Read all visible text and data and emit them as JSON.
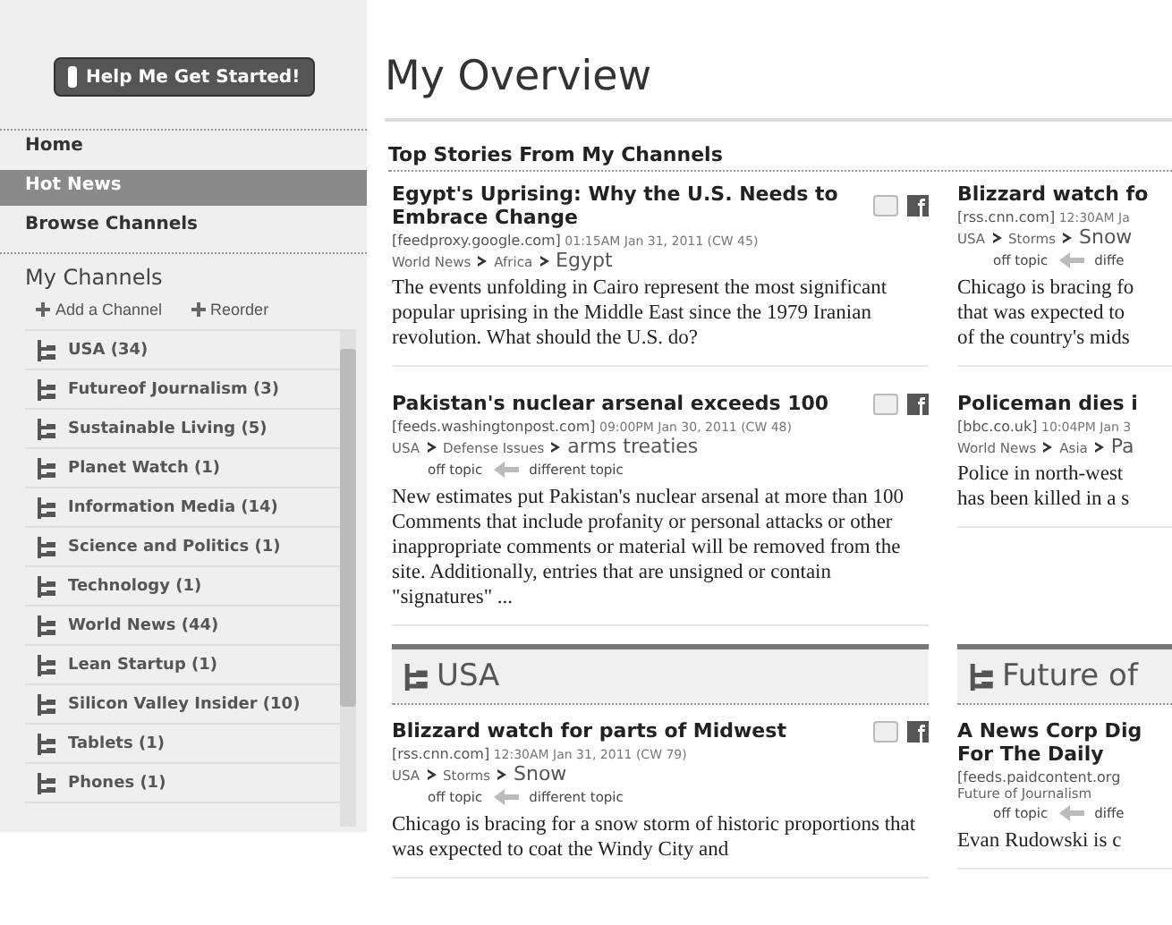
{
  "sidebar": {
    "help_button": "Help Me Get Started!",
    "nav": [
      {
        "label": "Home",
        "selected": false
      },
      {
        "label": "Hot News",
        "selected": true
      },
      {
        "label": "Browse Channels",
        "selected": false
      }
    ],
    "my_channels": {
      "title": "My Channels",
      "actions": [
        "Add a Channel",
        "Reorder"
      ],
      "items": [
        "USA (34)",
        "Futureof Journalism (3)",
        "Sustainable Living (5)",
        "Planet Watch (1)",
        "Information Media (14)",
        "Science and Politics (1)",
        "Technology (1)",
        "World News (44)",
        "Lean Startup (1)",
        "Silicon Valley Insider (10)",
        "Tablets (1)",
        "Phones (1)"
      ]
    }
  },
  "page_title": "My Overview",
  "top_stories": {
    "title": "Top Stories From My Channels",
    "columns": [
      [
        {
          "title": "Egypt's Uprising: Why the U.S. Needs to Embrace Change",
          "source": "[feedproxy.google.com]",
          "time": "01:15AM Jan 31, 2011 (CW 45)",
          "breadcrumb": [
            "World News",
            "Africa",
            "Egypt"
          ],
          "body": "The events unfolding in Cairo represent the most significant popular uprising in the Middle East since the 1979 Iranian revolution. What should the U.S. do?",
          "share": true
        },
        {
          "title": "Pakistan's nuclear arsenal exceeds 100",
          "source": "[feeds.washingtonpost.com]",
          "time": "09:00PM Jan 30, 2011 (CW 48)",
          "breadcrumb": [
            "USA",
            "Defense Issues",
            "arms treaties"
          ],
          "feedback": [
            "off topic",
            "different topic"
          ],
          "body": "New estimates put Pakistan's nuclear arsenal at more than 100 Comments that include profanity or personal attacks or other inappropriate comments or material will be removed from the site. Additionally, entries that are unsigned or contain \"signatures\" ...",
          "share": true
        }
      ],
      [
        {
          "title": [
            "Blizzard watch fo"
          ],
          "source": "[rss.cnn.com]",
          "time": "12:30AM Ja",
          "breadcrumb": [
            "USA",
            "Storms",
            "Snow"
          ],
          "feedback": [
            "off topic",
            "diffe"
          ],
          "body": [
            "Chicago is bracing fo",
            "that was expected to",
            "of the country's mids"
          ],
          "share": false
        },
        {
          "title": [
            "Policeman dies i"
          ],
          "source": "[bbc.co.uk]",
          "time": "10:04PM Jan 3",
          "breadcrumb": [
            "World News",
            "Asia",
            "Pa"
          ],
          "body": [
            "Police in north-west",
            "has been killed in a s"
          ],
          "share": false
        }
      ]
    ]
  },
  "sections": [
    {
      "title": "USA",
      "stories": [
        {
          "title": "Blizzard watch for parts of Midwest",
          "source": "[rss.cnn.com]",
          "time": "12:30AM Jan 31, 2011 (CW 79)",
          "breadcrumb": [
            "USA",
            "Storms",
            "Snow"
          ],
          "feedback": [
            "off topic",
            "different topic"
          ],
          "body": "Chicago is bracing for a snow storm of historic proportions that was expected to coat the Windy City and",
          "share": true
        }
      ]
    },
    {
      "title": "Future of",
      "stories": [
        {
          "title": [
            "A News Corp Dig",
            "For The Daily"
          ],
          "source": "[feeds.paidcontent.org",
          "breadcrumb": [
            "Future of Journalism"
          ],
          "feedback": [
            "off topic",
            "diffe"
          ],
          "body": [
            "Evan Rudowski is c"
          ],
          "share": false
        }
      ]
    }
  ]
}
